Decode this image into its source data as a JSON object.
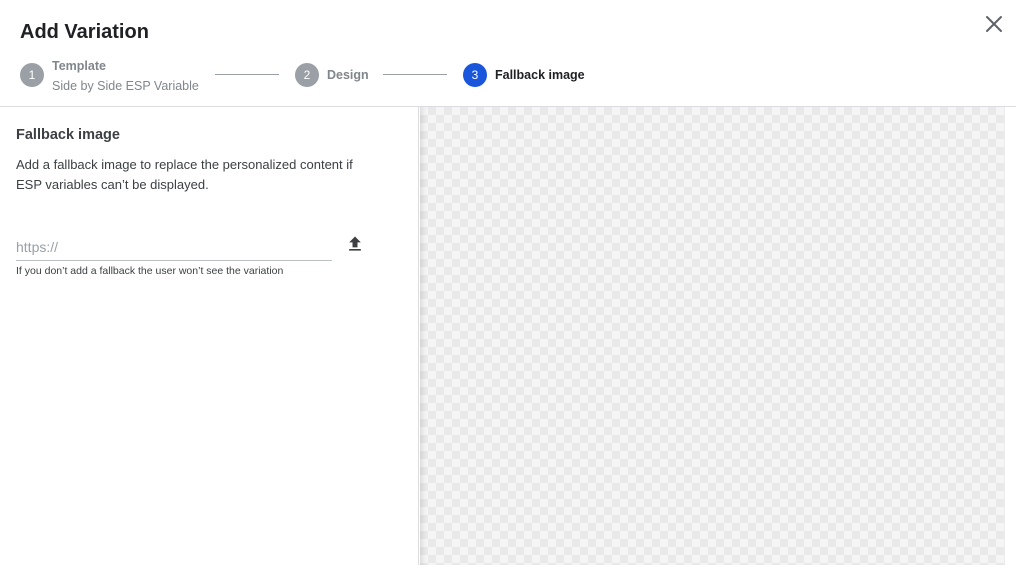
{
  "dialog": {
    "title": "Add Variation",
    "close_icon": "close-icon"
  },
  "stepper": {
    "steps": [
      {
        "number": "1",
        "label": "Template",
        "sublabel": "Side by Side ESP Variable",
        "state": "done"
      },
      {
        "number": "2",
        "label": "Design",
        "state": "done"
      },
      {
        "number": "3",
        "label": "Fallback image",
        "state": "active"
      }
    ]
  },
  "fallback": {
    "title": "Fallback image",
    "description": "Add a fallback image to replace the personalized content if ESP variables can’t be displayed.",
    "url_value": "",
    "url_placeholder": "https://",
    "upload_icon": "upload-icon",
    "helper": "If you don’t add a fallback the user won’t see the variation"
  },
  "colors": {
    "accent": "#1a56db",
    "step_inactive": "#9aa0a6"
  }
}
